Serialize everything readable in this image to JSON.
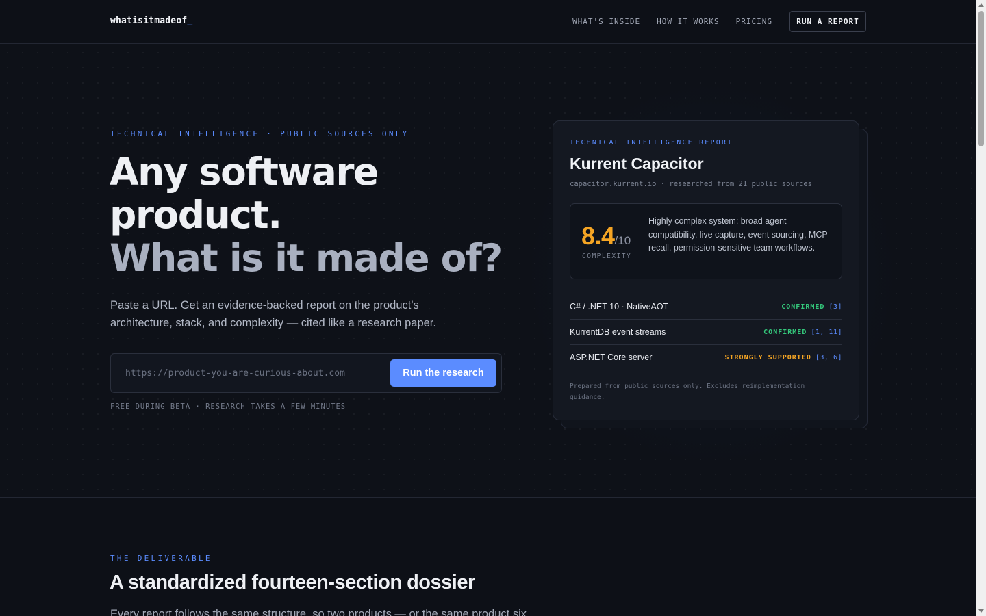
{
  "nav": {
    "logo": "whatisitmadeof",
    "logo_cursor": "_",
    "links": [
      "WHAT'S INSIDE",
      "HOW IT WORKS",
      "PRICING"
    ],
    "cta": "RUN A REPORT"
  },
  "hero": {
    "eyebrow": "TECHNICAL INTELLIGENCE · PUBLIC SOURCES ONLY",
    "title_line1": "Any software",
    "title_line2": "product.",
    "title_line3": "What is it made of?",
    "subtitle": "Paste a URL. Get an evidence-backed report on the product's architecture, stack, and complexity — cited like a research paper.",
    "input_placeholder": "https://product-you-are-curious-about.com",
    "input_value": "",
    "button": "Run the research",
    "note": "FREE DURING BETA · RESEARCH TAKES A FEW MINUTES"
  },
  "report": {
    "eyebrow": "TECHNICAL INTELLIGENCE REPORT",
    "title": "Kurrent Capacitor",
    "meta": "capacitor.kurrent.io · researched from 21 public sources",
    "score": "8.4",
    "score_den": "/10",
    "score_label": "COMPLEXITY",
    "score_desc": "Highly complex system: broad agent compatibility, live capture, event sourcing, MCP recall, permission-sensitive team workflows.",
    "findings": [
      {
        "name": "C# / .NET 10 · NativeAOT",
        "status": "CONFIRMED",
        "cite": "[3]"
      },
      {
        "name": "KurrentDB event streams",
        "status": "CONFIRMED",
        "cite": "[1, 11]"
      },
      {
        "name": "ASP.NET Core server",
        "status": "STRONGLY SUPPORTED",
        "cite": "[3, 6]"
      }
    ],
    "footer": "Prepared from public sources only. Excludes reimplementation guidance."
  },
  "section2": {
    "eyebrow": "THE DELIVERABLE",
    "title": "A standardized fourteen-section dossier",
    "subtitle": "Every report follows the same structure, so two products — or the same product six"
  },
  "colors": {
    "accent": "#5b8cff",
    "score": "#f5a524",
    "confirmed": "#34c77b",
    "strong": "#f5a524",
    "background": "#0e1118"
  }
}
